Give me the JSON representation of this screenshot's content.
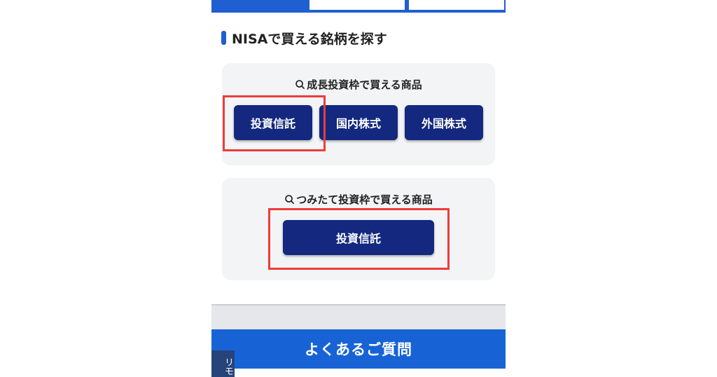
{
  "section": {
    "title": "NISAで買える銘柄を探す"
  },
  "growth": {
    "heading": "成長投資枠で買える商品",
    "buttons": [
      "投資信託",
      "国内株式",
      "外国株式"
    ]
  },
  "tsumitate": {
    "heading": "つみたて投資枠で買える商品",
    "button": "投資信託"
  },
  "faq": {
    "label": "よくあるご質問"
  },
  "side_tab": {
    "label": "リモ"
  },
  "colors": {
    "primary_button": "#13287e",
    "accent_blue": "#1763d6",
    "highlight_red": "#ef3b3b",
    "card_bg": "#f3f4f6"
  },
  "icons": [
    "search-icon"
  ]
}
